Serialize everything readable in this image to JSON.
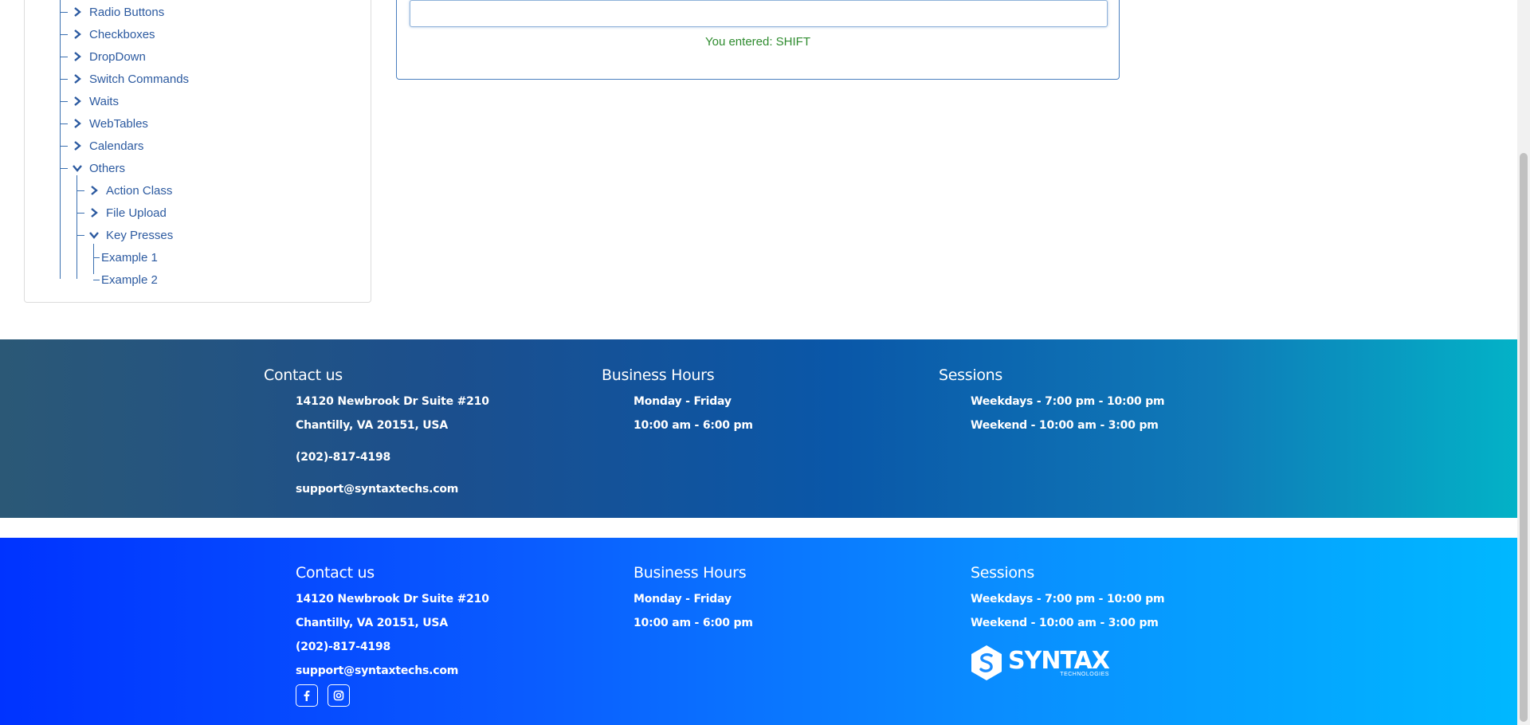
{
  "sidebar": {
    "items": [
      {
        "label": "Radio Buttons",
        "state": "collapsed"
      },
      {
        "label": "Checkboxes",
        "state": "collapsed"
      },
      {
        "label": "DropDown",
        "state": "collapsed"
      },
      {
        "label": "Switch Commands",
        "state": "collapsed"
      },
      {
        "label": "Waits",
        "state": "collapsed"
      },
      {
        "label": "WebTables",
        "state": "collapsed"
      },
      {
        "label": "Calendars",
        "state": "collapsed"
      },
      {
        "label": "Others",
        "state": "expanded"
      }
    ],
    "others_children": [
      {
        "label": "Action Class",
        "state": "collapsed"
      },
      {
        "label": "File Upload",
        "state": "collapsed"
      },
      {
        "label": "Key Presses",
        "state": "expanded"
      }
    ],
    "key_presses_children": [
      {
        "label": "Example 1"
      },
      {
        "label": "Example 2"
      }
    ]
  },
  "keypress": {
    "input_value": "",
    "result_text": "You entered: SHIFT"
  },
  "footer_top": {
    "contact": {
      "heading": "Contact us",
      "address1": "14120 Newbrook Dr Suite #210",
      "address2": "Chantilly, VA 20151, USA",
      "phone": "(202)-817-4198",
      "email": "support@syntaxtechs.com"
    },
    "hours": {
      "heading": "Business Hours",
      "days": "Monday - Friday",
      "time": "10:00 am - 6:00 pm"
    },
    "sessions": {
      "heading": "Sessions",
      "weekdays": "Weekdays - 7:00 pm - 10:00 pm",
      "weekend": "Weekend - 10:00 am - 3:00 pm"
    }
  },
  "footer_bottom": {
    "contact": {
      "heading": "Contact us",
      "address1": "14120 Newbrook Dr Suite #210",
      "address2": "Chantilly, VA 20151, USA",
      "phone": "(202)-817-4198",
      "email": "support@syntaxtechs.com"
    },
    "hours": {
      "heading": "Business Hours",
      "days": "Monday - Friday",
      "time": "10:00 am - 6:00 pm"
    },
    "sessions": {
      "heading": "Sessions",
      "weekdays": "Weekdays - 7:00 pm - 10:00 pm",
      "weekend": "Weekend - 10:00 am - 3:00 pm"
    },
    "social": [
      "facebook-icon",
      "instagram-icon"
    ],
    "logo": {
      "brand": "SYNTAX",
      "sub": "TECHNOLOGIES"
    }
  },
  "colors": {
    "link": "#2c5aa0",
    "result": "#2e8b2e",
    "footer_top_start": "#2b5876",
    "footer_top_end": "#03b2c7",
    "footer_bottom_start": "#0033ff",
    "footer_bottom_end": "#00b8ff"
  }
}
